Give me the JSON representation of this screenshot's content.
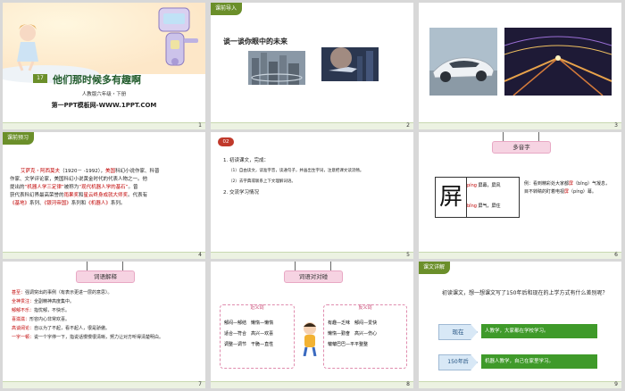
{
  "slides": [
    {
      "num": "1",
      "lesson_badge": "17",
      "title": "他们那时候多有趣啊",
      "subtitle": "人教版六年级・下册",
      "site": "第一PPT模板网-WWW.1PPT.COM"
    },
    {
      "num": "2",
      "tag": "课前导入",
      "heading": "谈一谈你眼中的未来"
    },
    {
      "num": "3"
    },
    {
      "num": "4",
      "tag": "课前预习",
      "lines": [
        {
          "a": "艾萨克・阿西莫夫",
          "b": "（1920－ -1992），",
          "c": "美国",
          "d": "科幻小说作家、科普"
        },
        {
          "a": "作家、文学评论家，美国科幻小说黄金时代的代表人物之一。他"
        },
        {
          "a": "提出的",
          "b": "“机器人学三定律”",
          "c": "被称为",
          "d": "“现代机器人学的基石”",
          "e": "。曾"
        },
        {
          "a": "获代表科幻界最高荣誉的",
          "b": "雨果奖",
          "c": "和",
          "d": "星云终身成就大师奖",
          "e": "。代表有"
        },
        {
          "a": "《基地》",
          "b": "系列、",
          "c": "《银河帝国》",
          "d": "系列和",
          "e": "《机器人》",
          "f": "系列。"
        }
      ]
    },
    {
      "num": "5",
      "tag": "02",
      "task": "1. 初读课文，完成：",
      "items": [
        "（1）自由读文，读准字音，读通句子，并画出生字词，注意把课文读流畅。",
        "（2）去字典或联系上下文理解词语。"
      ],
      "task2": "2. 交流学习情况"
    },
    {
      "num": "6",
      "board": "多音字",
      "big_char": "屏",
      "p1": "píng",
      "w1": "屏幕，屏风",
      "p2": "bǐng",
      "w2": "屏气，屏住",
      "ex_label": "例：",
      "ex1": "看到精彩处大家都",
      "ex_red": "屏",
      "ex2": "（bǐng）气凝息，目不转睛的盯着电视",
      "ex_red2": "屏",
      "ex3": "（píng）幕。"
    },
    {
      "num": "7",
      "board": "词语解释",
      "defs": [
        {
          "w": "甚至：",
          "d": "强调突出的事例（有表示更进一层的意思）。"
        },
        {
          "w": "全神贯注：",
          "d": "全副精神高度集中。"
        },
        {
          "w": "郁郁不乐：",
          "d": "指忧郁，不快乐。"
        },
        {
          "w": "喜滋滋：",
          "d": "形容内心非常欢喜。"
        },
        {
          "w": "高谈阔论：",
          "d": "自以为了不起，看不起人，很是骄傲。"
        },
        {
          "w": "一字一顿：",
          "d": "说一个字停一下，指说话慢慢很清晰，努力让对方听得清楚明白。"
        }
      ]
    },
    {
      "num": "8",
      "board": "词语对对碰",
      "syn": "近义词",
      "ant": "反义词",
      "syn_pairs": [
        [
          "郁闷",
          "郁结"
        ],
        [
          "懒惰",
          "懒惰"
        ],
        [
          "适合",
          "符合"
        ],
        [
          "高兴",
          "欢喜"
        ],
        [
          "调整",
          "调节"
        ],
        [
          "干脆",
          "直性"
        ]
      ],
      "ant_pairs": [
        [
          "有趣",
          "乏味"
        ],
        [
          "郁闷",
          "爱快"
        ],
        [
          "懒惰",
          "勤奋"
        ],
        [
          "高兴",
          "伤心"
        ],
        [
          "皱皱巴巴",
          "平平整整"
        ]
      ]
    },
    {
      "num": "9",
      "tag": "课文详解",
      "question": "初读课文，想一想课文写了150年后和现在的上学方式有什么差别呢？",
      "now": "现在",
      "now_desc": "人教学，大家都在学校学习。",
      "later": "150年后",
      "later_desc": "机器人教学，自己在家里学习。"
    }
  ]
}
